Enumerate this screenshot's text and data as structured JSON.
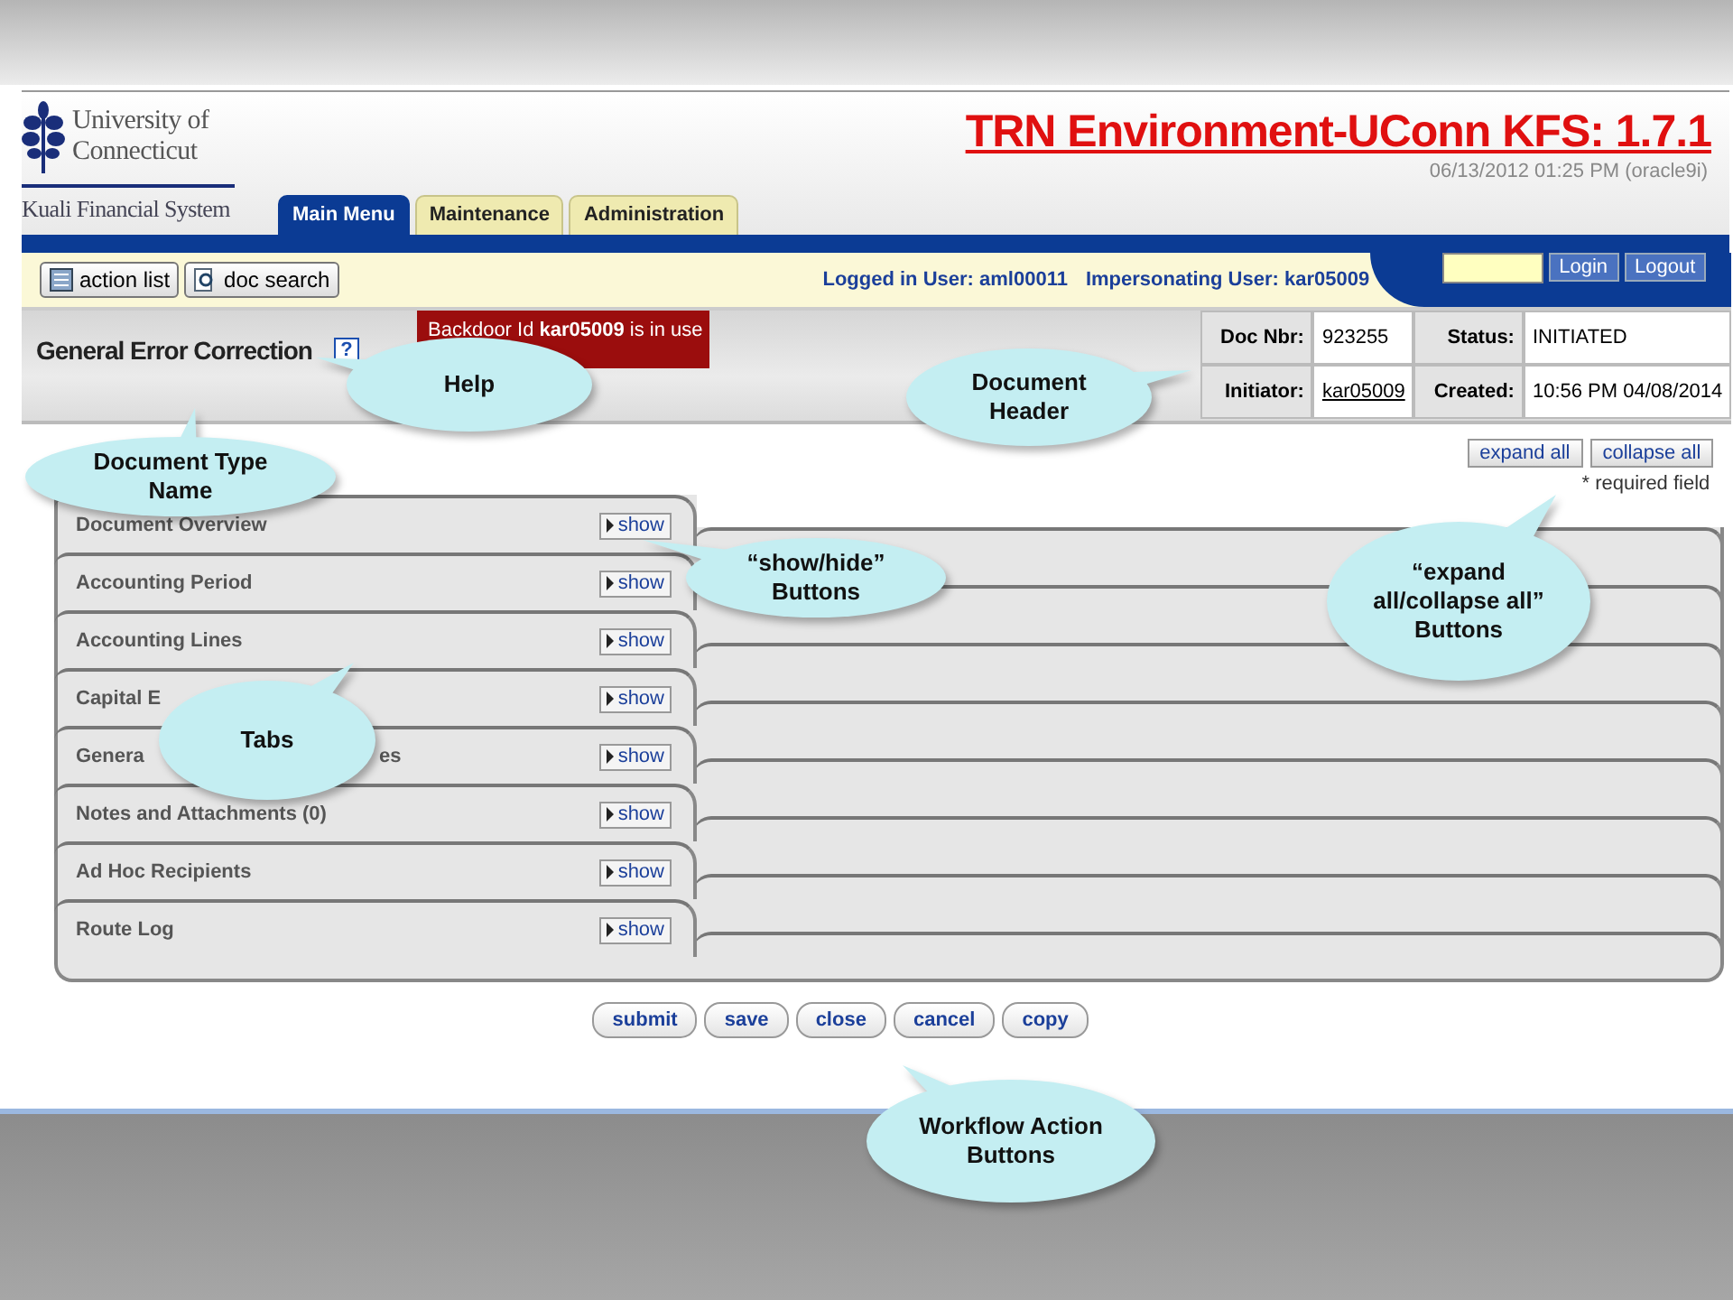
{
  "screen": {
    "logo": {
      "line_1": "University of",
      "line_2": "Connecticut",
      "subtitle": "Kuali Financial System"
    },
    "environment_title": "TRN Environment-UConn KFS: 1.7.1",
    "timestamp": "06/13/2012 01:25 PM (oracle9i)",
    "nav_tabs": [
      {
        "label": "Main Menu",
        "selected": true
      },
      {
        "label": "Maintenance",
        "selected": false
      },
      {
        "label": "Administration",
        "selected": false
      }
    ],
    "toolbar_buttons": [
      "action list",
      "doc search"
    ],
    "user_info": [
      "Logged in User: aml00011",
      "Impersonating User: kar05009"
    ],
    "login_buttons": [
      "Login",
      "Logout"
    ],
    "document_title": "General Error Correction",
    "help_button": "?",
    "backdoor_notice": "Backdoor Id **kar05009** is in use",
    "doc_header": [
      {
        "label": "Doc Nbr:",
        "value": "923255",
        "link": false
      },
      {
        "label": "Status:",
        "value": "INITIATED",
        "link": false
      },
      {
        "label": "Initiator:",
        "value": "kar05009",
        "link": true
      },
      {
        "label": "Created:",
        "value": "10:56 PM 04/08/2014",
        "link": false
      }
    ],
    "expand_buttons": [
      "expand all",
      "collapse all"
    ],
    "required_note": "* required field",
    "sections": [
      {
        "label": "Document Overview",
        "button": "show"
      },
      {
        "label": "Accounting Period",
        "button": "show"
      },
      {
        "label": "Accounting Lines",
        "button": "show"
      },
      {
        "label": "Capital E",
        "button": "show"
      },
      {
        "label": "Genera",
        "label_tail": "es",
        "button": "show"
      },
      {
        "label": "Notes and Attachments (0)",
        "button": "show"
      },
      {
        "label": "Ad Hoc Recipients",
        "button": "show"
      },
      {
        "label": "Route Log",
        "button": "show"
      }
    ],
    "action_buttons": [
      "submit",
      "save",
      "close",
      "cancel",
      "copy"
    ]
  },
  "callouts": [
    {
      "text": "Help"
    },
    {
      "text": "Document Header"
    },
    {
      "text": "Document Type Name"
    },
    {
      "text": "“show/hide” Buttons"
    },
    {
      "text": "“expand all/collapse all” Buttons"
    },
    {
      "text": "Tabs"
    },
    {
      "text": "Workflow Action Buttons"
    }
  ]
}
